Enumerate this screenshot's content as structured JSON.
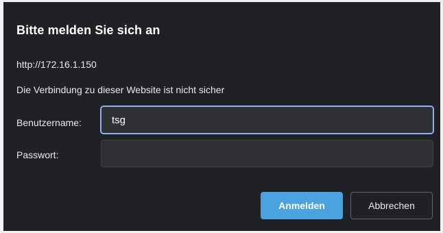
{
  "dialog": {
    "title": "Bitte melden Sie sich an",
    "origin": "http://172.16.1.150",
    "warning": "Die Verbindung zu dieser Website ist nicht sicher",
    "username_label": "Benutzername:",
    "username_value": "tsg",
    "password_label": "Passwort:",
    "password_value": "",
    "login_label": "Anmelden",
    "cancel_label": "Abbrechen"
  },
  "colors": {
    "dialog_background": "#202124",
    "input_background": "#303134",
    "focus_ring": "#8ab4f8",
    "primary_button": "#4aa3df"
  }
}
